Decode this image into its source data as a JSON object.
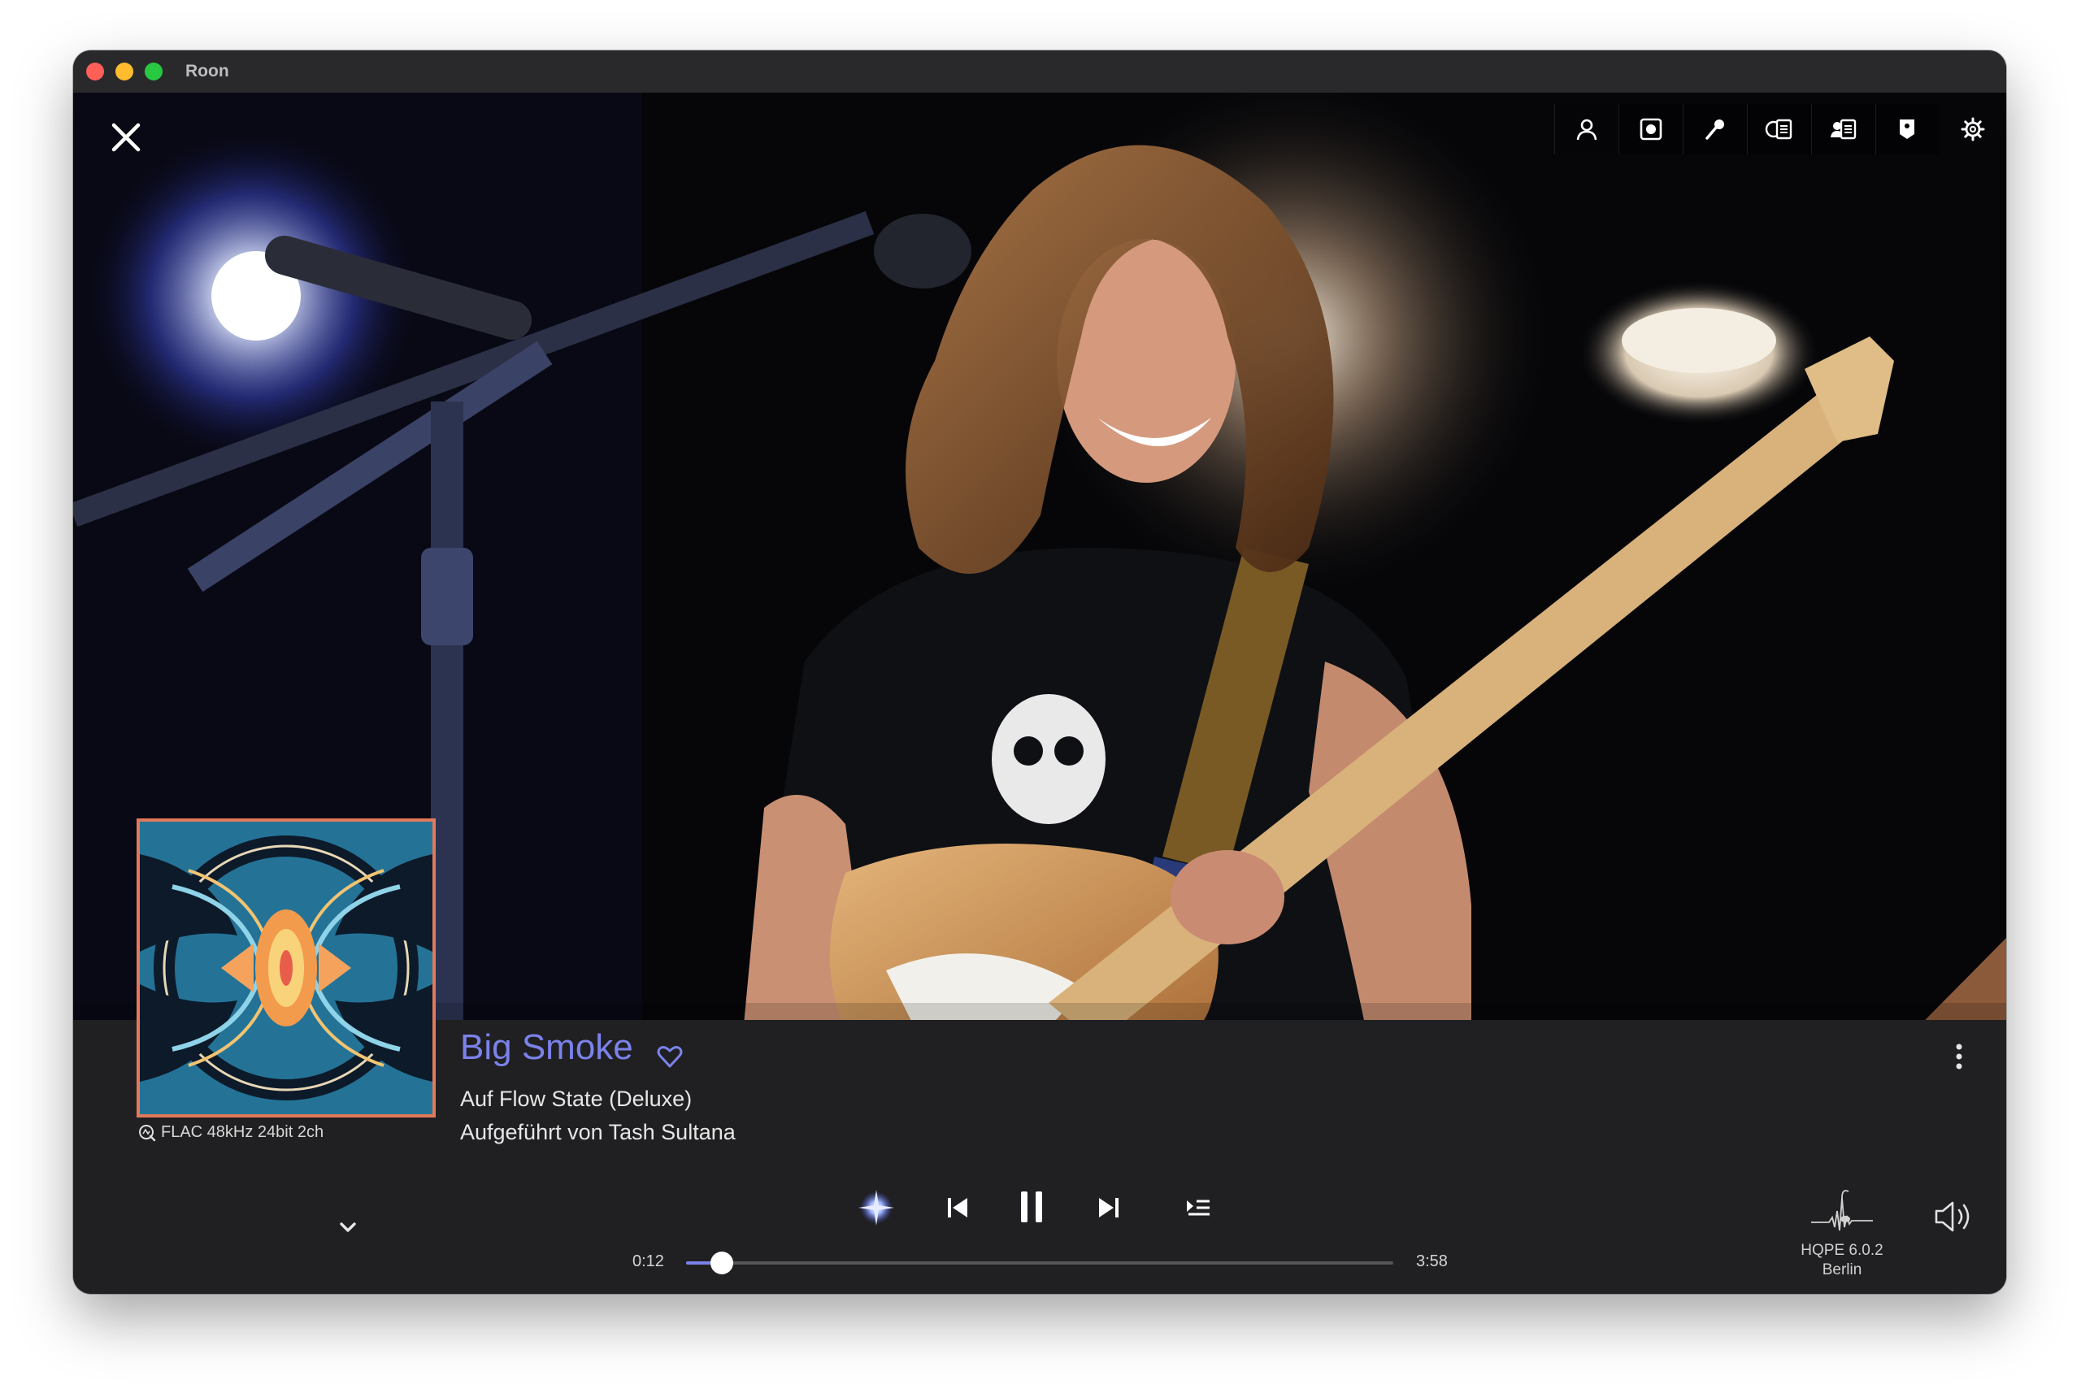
{
  "window": {
    "title": "Roon"
  },
  "toolbar": {
    "items": [
      {
        "name": "artist",
        "icon": "person-icon",
        "active": true
      },
      {
        "name": "album",
        "icon": "record-icon"
      },
      {
        "name": "lyrics",
        "icon": "microphone-icon"
      },
      {
        "name": "album-credits",
        "icon": "disc-document-icon"
      },
      {
        "name": "artist-credits",
        "icon": "person-document-icon"
      },
      {
        "name": "tags",
        "icon": "tag-icon"
      },
      {
        "name": "settings",
        "icon": "gear-icon"
      }
    ]
  },
  "now_playing": {
    "title": "Big Smoke",
    "album_line": "Auf Flow State (Deluxe)",
    "artist_line": "Aufgeführt von Tash Sultana",
    "format": "FLAC 48kHz 24bit 2ch",
    "elapsed": "0:12",
    "duration": "3:58",
    "progress": 0.05
  },
  "zone": {
    "name": "HQPE 6.0.2",
    "location": "Berlin"
  },
  "colors": {
    "accent": "#7b82ea",
    "panel": "#202022",
    "album_border": "#e2795a"
  }
}
